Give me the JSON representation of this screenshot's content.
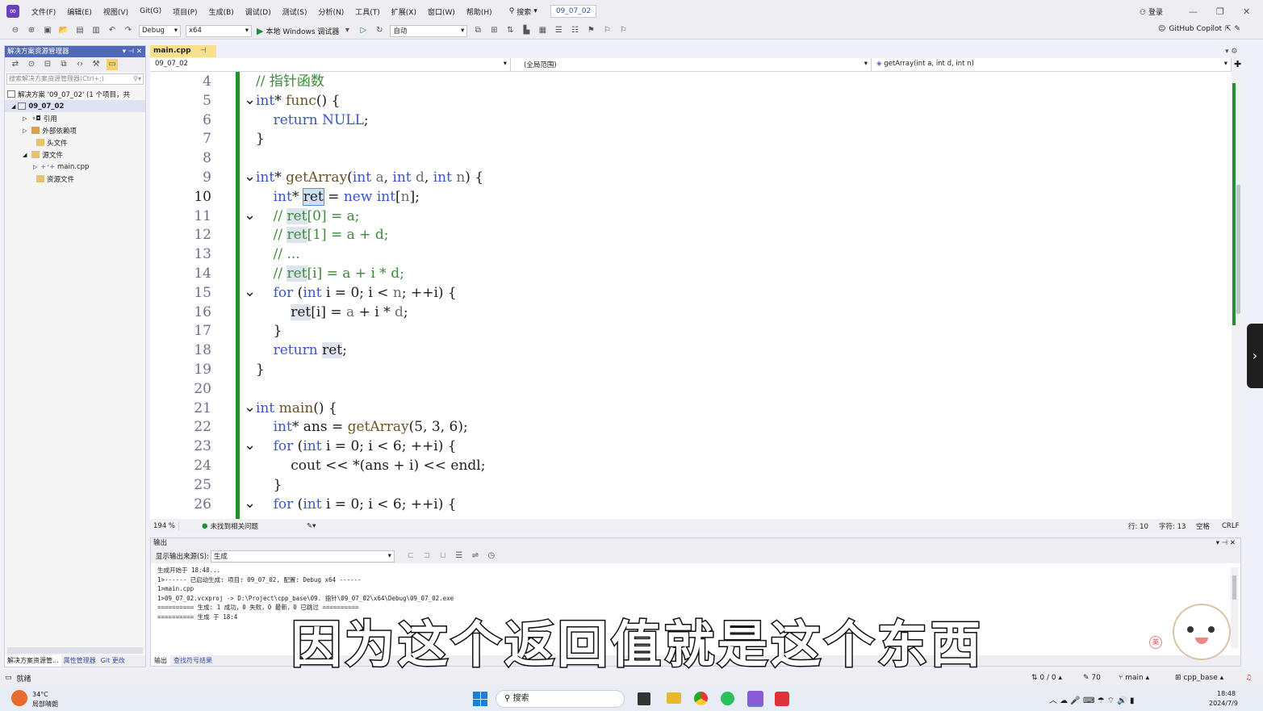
{
  "menubar": {
    "items": [
      "文件(F)",
      "编辑(E)",
      "视图(V)",
      "Git(G)",
      "项目(P)",
      "生成(B)",
      "调试(D)",
      "测试(S)",
      "分析(N)",
      "工具(T)",
      "扩展(X)",
      "窗口(W)",
      "帮助(H)"
    ],
    "search_label": "搜索",
    "project_name": "09_07_02",
    "login_label": "登录"
  },
  "toolbar": {
    "config": "Debug",
    "platform": "x64",
    "run_label": "本地 Windows 调试器",
    "auto_label": "自动",
    "copilot_label": "GitHub Copilot"
  },
  "solution_explorer": {
    "title": "解决方案资源管理器",
    "search_placeholder": "搜索解决方案资源管理器(Ctrl+;)",
    "tree": [
      {
        "label": "解决方案 '09_07_02' (1 个项目，共",
        "indent": 0
      },
      {
        "label": "09_07_02",
        "indent": 1
      },
      {
        "label": "引用",
        "indent": 2
      },
      {
        "label": "外部依赖项",
        "indent": 2
      },
      {
        "label": "头文件",
        "indent": 2
      },
      {
        "label": "源文件",
        "indent": 2
      },
      {
        "label": "main.cpp",
        "indent": 3
      },
      {
        "label": "资源文件",
        "indent": 2
      }
    ],
    "bottom_tabs": [
      "解决方案资源管...",
      "属性管理器",
      "Git 更改"
    ]
  },
  "editor": {
    "tab_label": "main.cpp",
    "nav_project": "09_07_02",
    "nav_scope": "(全局范围)",
    "nav_member": "getArray(int a, int d, int n)",
    "zoom": "194 %",
    "issues": "未找到相关问题",
    "position": {
      "line": "行: 10",
      "col": "字符: 13",
      "spaces": "空格",
      "eol": "CRLF"
    }
  },
  "code_lines": [
    {
      "n": "4"
    },
    {
      "n": "5"
    },
    {
      "n": "6"
    },
    {
      "n": "7"
    },
    {
      "n": "8"
    },
    {
      "n": "9"
    },
    {
      "n": "10"
    },
    {
      "n": "11"
    },
    {
      "n": "12"
    },
    {
      "n": "13"
    },
    {
      "n": "14"
    },
    {
      "n": "15"
    },
    {
      "n": "16"
    },
    {
      "n": "17"
    },
    {
      "n": "18"
    },
    {
      "n": "19"
    },
    {
      "n": "20"
    },
    {
      "n": "21"
    },
    {
      "n": "22"
    },
    {
      "n": "23"
    },
    {
      "n": "24"
    },
    {
      "n": "25"
    },
    {
      "n": "26"
    }
  ],
  "output": {
    "title": "输出",
    "source_label": "显示输出来源(S):",
    "source_value": "生成",
    "lines": [
      "生成开始于 18:48...",
      "1>------ 已启动生成: 项目: 09_07_02, 配置: Debug x64 ------",
      "1>main.cpp",
      "1>09_07_02.vcxproj -> D:\\Project\\cpp_base\\09. 指针\\09_07_02\\x64\\Debug\\09_07_02.exe",
      "========== 生成: 1 成功，0 失败，0 最新，0 已跳过 ==========",
      "========== 生成 于 18:4"
    ],
    "bottom_tabs": [
      "输出",
      "查找符号结果"
    ]
  },
  "subtitle": "因为这个返回值就是这个东西",
  "statusbar": {
    "ready": "就绪",
    "changes": "0 / 0",
    "commits": "70",
    "branch": "main",
    "repo": "cpp_base"
  },
  "taskbar": {
    "weather_temp": "34°C",
    "weather_desc": "局部晴朗",
    "search_label": "搜索",
    "time": "18:48",
    "date": "2024/7/9"
  }
}
